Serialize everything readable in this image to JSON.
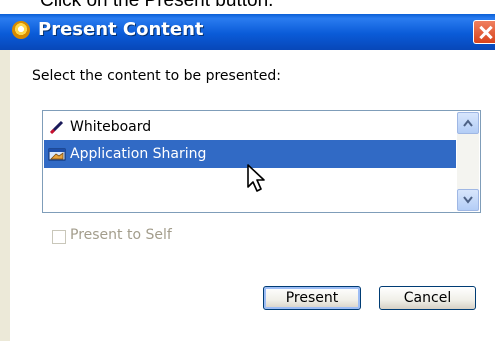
{
  "instruction": "Click on the Present button.",
  "dialog": {
    "title": "Present Content",
    "prompt": "Select the content to be presented:",
    "list_items": [
      {
        "label": "Whiteboard",
        "icon": "pen-icon",
        "selected": false
      },
      {
        "label": "Application Sharing",
        "icon": "application-sharing-icon",
        "selected": true
      }
    ],
    "checkbox": {
      "label": "Present to Self",
      "checked": false,
      "enabled": false
    },
    "buttons": {
      "present": "Present",
      "cancel": "Cancel"
    }
  },
  "colors": {
    "titlebar": "#0a5bd8",
    "selection": "#316ac5",
    "dialog_bg": "#ece9d8",
    "close": "#d8431c"
  }
}
